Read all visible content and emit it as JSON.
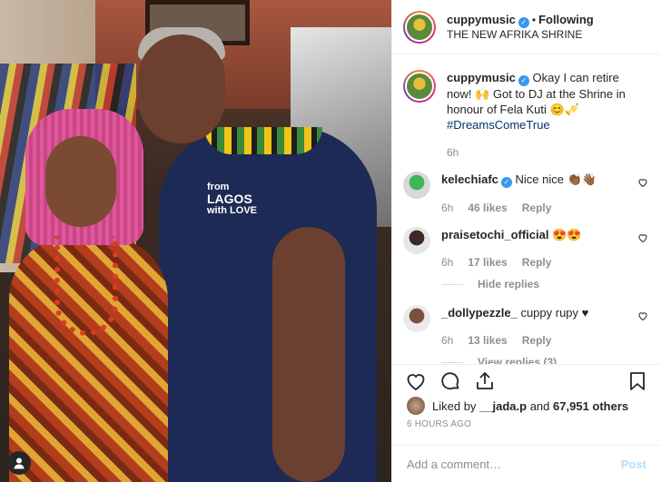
{
  "photo": {
    "shirt_print": [
      "from",
      "LAGOS",
      "with LOVE"
    ]
  },
  "header": {
    "username": "cuppymusic",
    "follow_label": "Following",
    "location": "THE NEW AFRIKA SHRINE"
  },
  "caption": {
    "username": "cuppymusic",
    "text": "Okay I can retire now! 🙌 Got to DJ at the Shrine in honour of Fela Kuti 😊🎺",
    "hashtag": "#DreamsComeTrue",
    "time": "6h"
  },
  "comments": [
    {
      "username": "kelechiafc",
      "verified": true,
      "text": "Nice nice 👏🏾👋🏾",
      "time": "6h",
      "likes": "46 likes",
      "reply": "Reply"
    },
    {
      "username": "praisetochi_official",
      "verified": false,
      "text": "😍😍",
      "time": "6h",
      "likes": "17 likes",
      "reply": "Reply",
      "replies_label": "Hide replies"
    },
    {
      "username": "_dollypezzle_",
      "verified": false,
      "text": "cuppy rupy ♥",
      "time": "6h",
      "likes": "13 likes",
      "reply": "Reply",
      "replies_label": "View replies (3)"
    }
  ],
  "likes": {
    "prefix": "Liked by",
    "user": "__jada.p",
    "middle": "and",
    "count": "67,951 others"
  },
  "timestamp": "6 HOURS AGO",
  "add_comment": {
    "placeholder": "Add a comment…",
    "post_label": "Post"
  },
  "colors": {
    "link": "#003569",
    "verified": "#3897f0",
    "post_disabled": "#b2dffc",
    "muted": "#8e8e8e"
  },
  "icons": [
    "heart-icon",
    "comment-icon",
    "share-icon",
    "bookmark-icon",
    "user-tag-icon",
    "verified-badge-icon"
  ]
}
